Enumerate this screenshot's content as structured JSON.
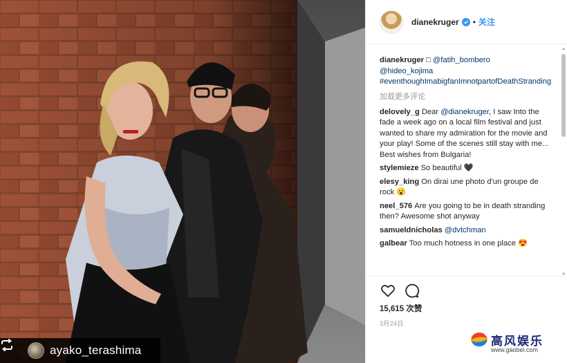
{
  "post": {
    "author": "dianekruger",
    "follow_label": "关注",
    "separator": "•",
    "verified": true,
    "likes": "15,615 次赞",
    "date": "3月24日",
    "load_more": "加载更多评论"
  },
  "repost": {
    "username": "ayako_terashima"
  },
  "comments": [
    {
      "user": "dianekruger",
      "parts": [
        {
          "type": "text",
          "value": "□ "
        },
        {
          "type": "mention",
          "value": "@fatih_bombero"
        },
        {
          "type": "text",
          "value": " "
        },
        {
          "type": "mention",
          "value": "@hideo_kojima"
        },
        {
          "type": "text",
          "value": " "
        },
        {
          "type": "mention",
          "value": "#eventhoughImabigfanImnotpartofDeathStranding"
        }
      ]
    },
    {
      "user": "delovely_g",
      "parts": [
        {
          "type": "text",
          "value": "Dear "
        },
        {
          "type": "mention",
          "value": "@dianekruger"
        },
        {
          "type": "text",
          "value": ", I saw Into the fade a week ago on a local film festival and just wanted to share my admiration for the movie and your play! Some of the scenes still stay with me... Best wishes from Bulgaria!"
        }
      ]
    },
    {
      "user": "stylemieze",
      "parts": [
        {
          "type": "text",
          "value": "So beautiful 🖤"
        }
      ]
    },
    {
      "user": "elesy_king",
      "parts": [
        {
          "type": "text",
          "value": "On dirai une photo d'un groupe de rock 😮"
        }
      ]
    },
    {
      "user": "neel_576",
      "parts": [
        {
          "type": "text",
          "value": "Are you going to be in death stranding then? Awesome shot anyway"
        }
      ]
    },
    {
      "user": "samueldnicholas",
      "parts": [
        {
          "type": "mention",
          "value": "@dvtchman"
        }
      ]
    },
    {
      "user": "galbear",
      "parts": [
        {
          "type": "text",
          "value": "Too much hotness in one place 😍"
        }
      ]
    }
  ],
  "icons": {
    "like": "heart-icon",
    "comment": "comment-icon",
    "verified": "verified-badge-icon",
    "repost": "repost-icon"
  },
  "watermark": {
    "title": "高风娱乐",
    "url": "www.gaobei.com"
  },
  "colors": {
    "link": "#003569",
    "follow": "#3897f0",
    "muted": "#999999"
  }
}
